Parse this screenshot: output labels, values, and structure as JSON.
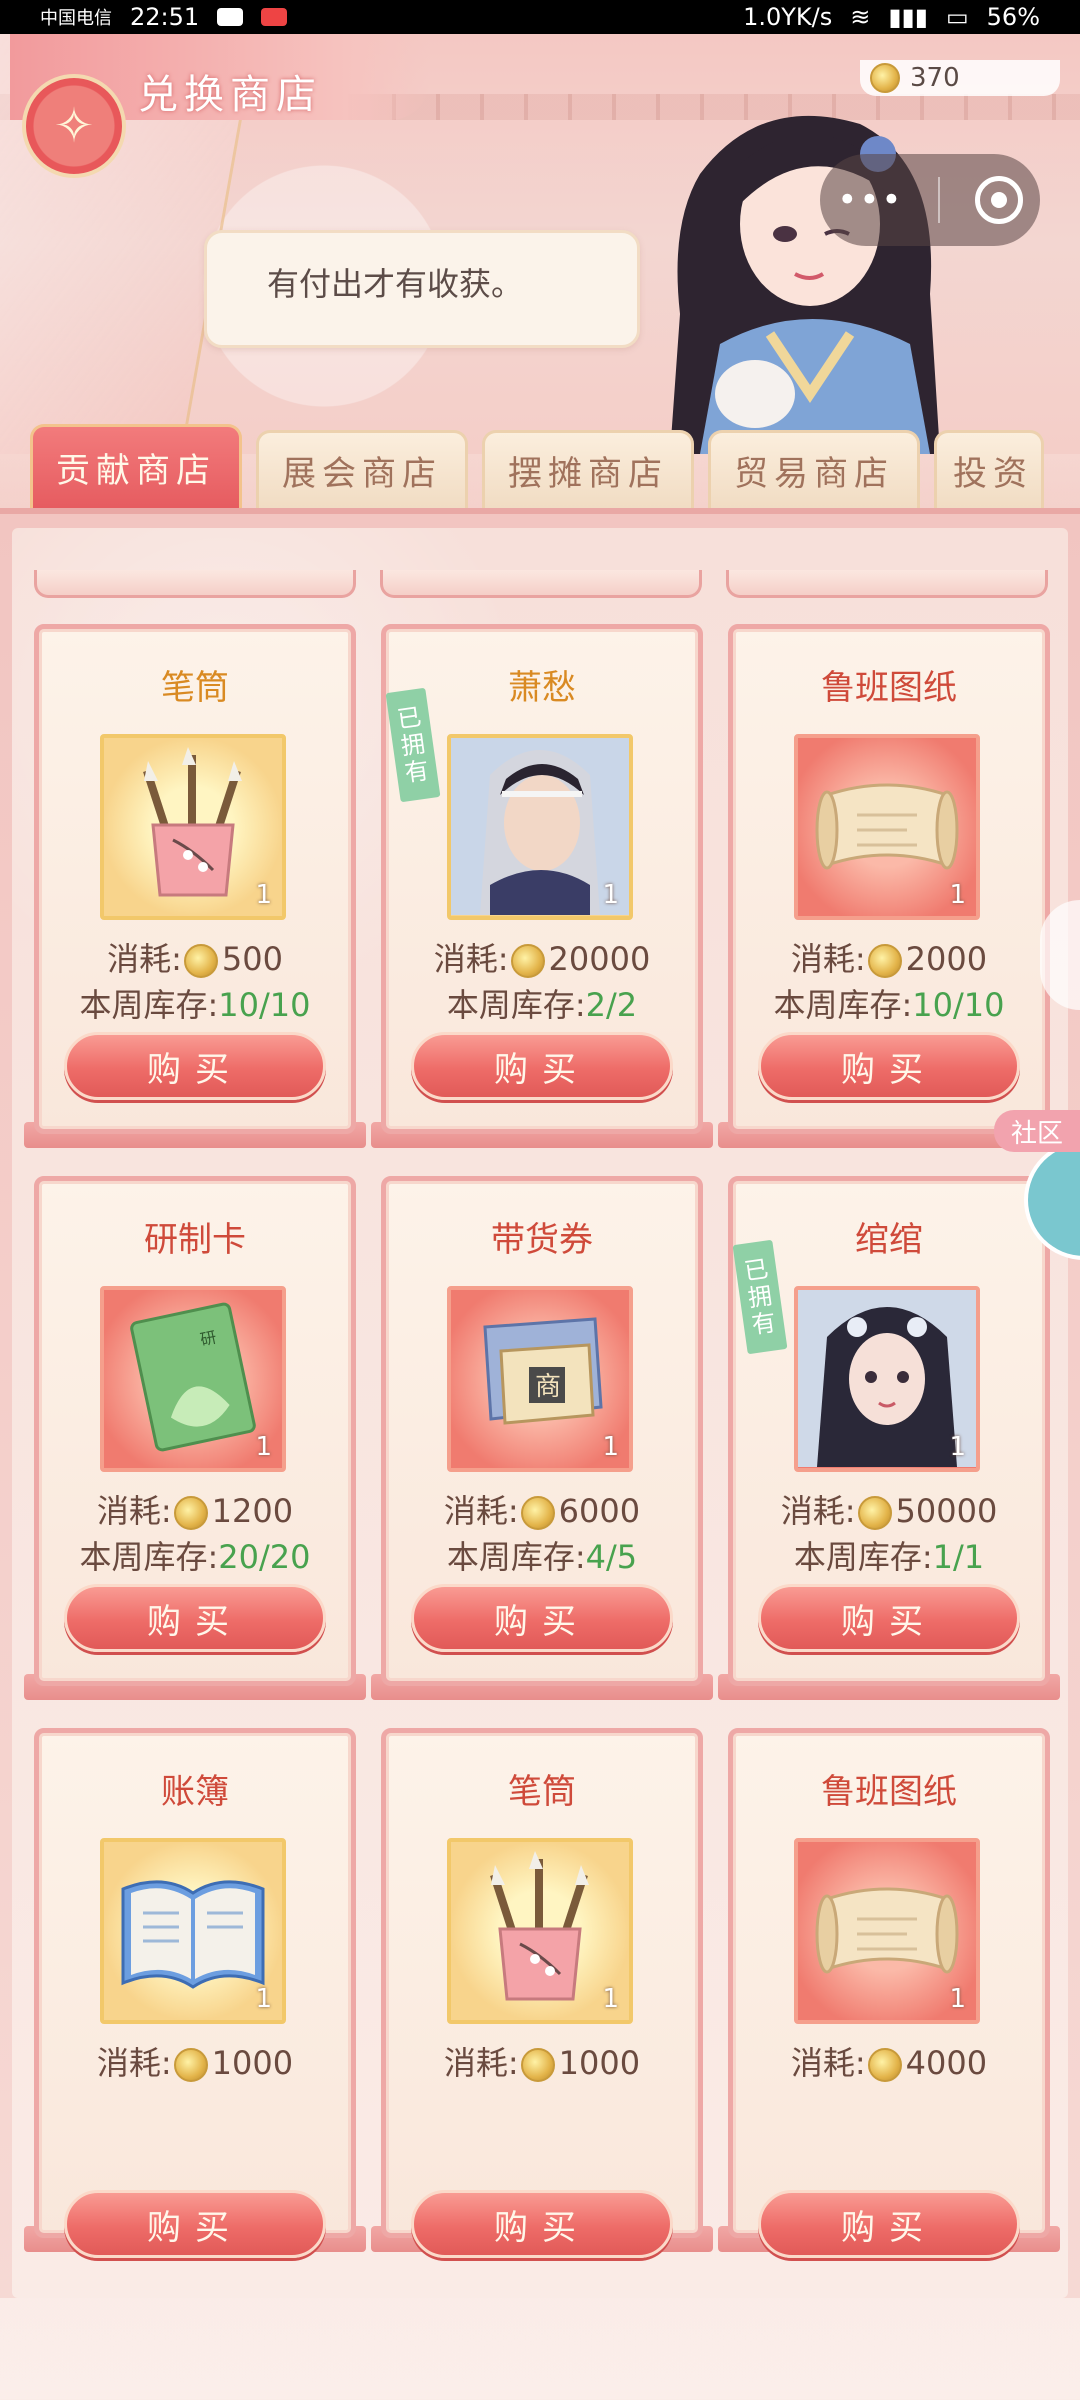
{
  "status_bar": {
    "carrier": "中国电信",
    "time": "22:51",
    "net_speed": "1.0YK/s",
    "battery": "56%"
  },
  "header": {
    "title": "兑换商店",
    "currency_amount": "370",
    "speech": "有付出才有收获。"
  },
  "tabs": [
    {
      "label": "贡献商店",
      "active": true
    },
    {
      "label": "展会商店",
      "active": false
    },
    {
      "label": "摆摊商店",
      "active": false
    },
    {
      "label": "贸易商店",
      "active": false
    },
    {
      "label": "投资",
      "active": false
    }
  ],
  "labels": {
    "cost": "消耗:",
    "stock": "本周库存:",
    "buy": "购买",
    "owned": [
      "已",
      "拥",
      "有"
    ]
  },
  "items": [
    {
      "name": "笔筒",
      "qty": "1",
      "cost": "500",
      "stock": "10/10",
      "owned": false,
      "icon": "brush-pot-icon",
      "bg": "gold",
      "name_color": "gold"
    },
    {
      "name": "萧愁",
      "qty": "1",
      "cost": "20000",
      "stock": "2/2",
      "owned": true,
      "icon": "male-character-portrait-icon",
      "bg": "gold",
      "name_color": "gold"
    },
    {
      "name": "鲁班图纸",
      "qty": "1",
      "cost": "2000",
      "stock": "10/10",
      "owned": false,
      "icon": "scroll-blueprint-icon",
      "bg": "red",
      "name_color": "red"
    },
    {
      "name": "研制卡",
      "qty": "1",
      "cost": "1200",
      "stock": "20/20",
      "owned": false,
      "icon": "research-card-icon",
      "bg": "red",
      "name_color": "red"
    },
    {
      "name": "带货券",
      "qty": "1",
      "cost": "6000",
      "stock": "4/5",
      "owned": false,
      "icon": "merchant-coupon-icon",
      "bg": "red",
      "name_color": "red"
    },
    {
      "name": "绾绾",
      "qty": "1",
      "cost": "50000",
      "stock": "1/1",
      "owned": true,
      "icon": "female-character-portrait-icon",
      "bg": "red",
      "name_color": "red"
    },
    {
      "name": "账簿",
      "qty": "1",
      "cost": "1000",
      "stock": null,
      "owned": false,
      "icon": "ledger-book-icon",
      "bg": "gold",
      "name_color": "red"
    },
    {
      "name": "笔筒",
      "qty": "1",
      "cost": "1000",
      "stock": null,
      "owned": false,
      "icon": "brush-pot-icon",
      "bg": "gold",
      "name_color": "red"
    },
    {
      "name": "鲁班图纸",
      "qty": "1",
      "cost": "4000",
      "stock": null,
      "owned": false,
      "icon": "scroll-blueprint-icon",
      "bg": "red",
      "name_color": "red"
    }
  ],
  "side": {
    "community_label": "社区"
  },
  "colors": {
    "accent_red": "#e65c60",
    "stock_green": "#48a24e",
    "owned_green": "#8fd0a6",
    "name_red": "#cf4a3a",
    "name_gold": "#d98a22"
  }
}
